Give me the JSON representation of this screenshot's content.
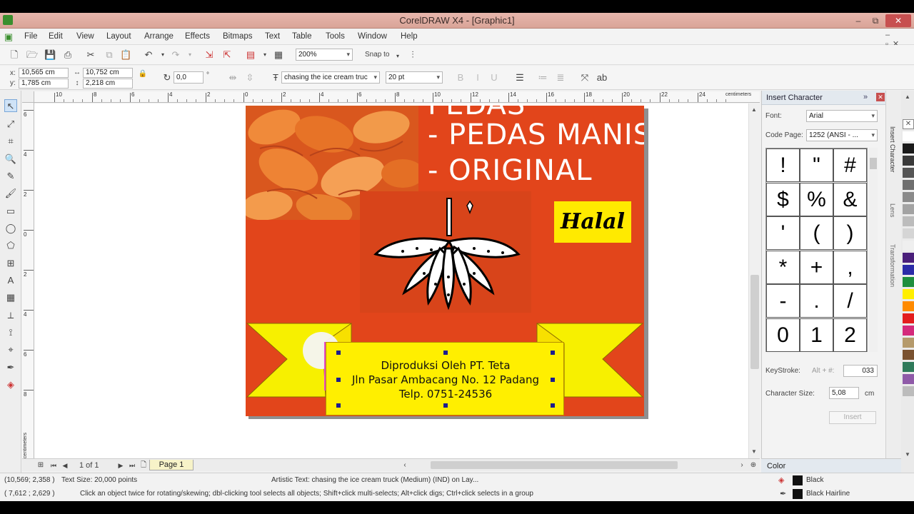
{
  "window": {
    "title": "CorelDRAW X4 - [Graphic1]",
    "min": "–",
    "max": "⧉",
    "close": "✕"
  },
  "menu": [
    "File",
    "Edit",
    "View",
    "Layout",
    "Arrange",
    "Effects",
    "Bitmaps",
    "Text",
    "Table",
    "Tools",
    "Window",
    "Help"
  ],
  "toolbar": {
    "zoom": "200%",
    "snap_to": "Snap to"
  },
  "propertybar": {
    "x_label": "x:",
    "x": "10,565 cm",
    "y_label": "y:",
    "y": "1,785 cm",
    "w": "10,752 cm",
    "h": "2,218 cm",
    "angle": "0,0",
    "angle_unit": "°",
    "font": "chasing the ice cream truc",
    "size": "20 pt"
  },
  "ruler": {
    "top_ticks": [
      "10",
      "8",
      "6",
      "4",
      "2",
      "0",
      "2",
      "4",
      "6",
      "8",
      "10",
      "12",
      "14",
      "16",
      "18",
      "20",
      "22",
      "24"
    ],
    "unit": "centimeters",
    "left_ticks": [
      "6",
      "4",
      "2",
      "0",
      "2",
      "4",
      "6",
      "8"
    ],
    "left_unit": "centimeters"
  },
  "design": {
    "flavors": [
      "PEDAS",
      "- PEDAS MANIS",
      "- ORIGINAL"
    ],
    "halal": "Halal",
    "banner_lines": [
      "Diproduksi Oleh PT. Teta",
      "Jln Pasar Ambacang No. 12 Padang",
      "Telp. 0751-24536"
    ],
    "colors": {
      "background": "#e2451b",
      "banner": "#ffef00",
      "halal_box": "#ffea00",
      "ribbon": "#f7f000"
    }
  },
  "page_nav": {
    "page_count": "1 of 1",
    "page_tab": "Page 1"
  },
  "status": {
    "coords1": "(10,569; 2,358 )",
    "text_size": "Text Size: 20,000 points",
    "object_info": "Artistic Text: chasing the ice cream truck (Medium) (IND) on Lay...",
    "coords2": "( 7,612 ; 2,629 )",
    "hint": "Click an object twice for rotating/skewing; dbl-clicking tool selects all objects; Shift+click multi-selects; Alt+click digs; Ctrl+click selects in a group",
    "fill": "Black",
    "outline": "Black  Hairline"
  },
  "docker": {
    "title": "Insert Character",
    "font_label": "Font:",
    "font_value": "Arial",
    "codepage_label": "Code Page:",
    "codepage_value": "1252  (ANSI - ...",
    "chars": [
      "!",
      "\"",
      "#",
      "$",
      "%",
      "&",
      "'",
      "(",
      ")",
      "*",
      "+",
      ",",
      "-",
      ".",
      "/",
      "0",
      "1",
      "2"
    ],
    "keystroke_label": "KeyStroke:",
    "keystroke_alt": "Alt + #:",
    "keystroke_value": "033",
    "charsize_label": "Character Size:",
    "charsize_value": "5,08",
    "charsize_unit": "cm",
    "insert_button": "Insert"
  },
  "sidetabs": [
    "Insert Character",
    "Lens",
    "Transformation"
  ],
  "color_docker": {
    "title": "Color"
  },
  "palette_colors": [
    "#ffffff",
    "#1a1a1a",
    "#3a3a3a",
    "#555555",
    "#6f6f6f",
    "#8a8a8a",
    "#a3a3a3",
    "#bcbcbc",
    "#d5d5d5",
    "#efefef",
    "#4a1f7a",
    "#2b2ba8",
    "#1e8e3e",
    "#ffef00",
    "#ff8a00",
    "#e31d1d",
    "#d42a7b",
    "#b59a6b",
    "#7a5230",
    "#2f7a5a",
    "#8f5aa8",
    "#bcbcbc"
  ]
}
